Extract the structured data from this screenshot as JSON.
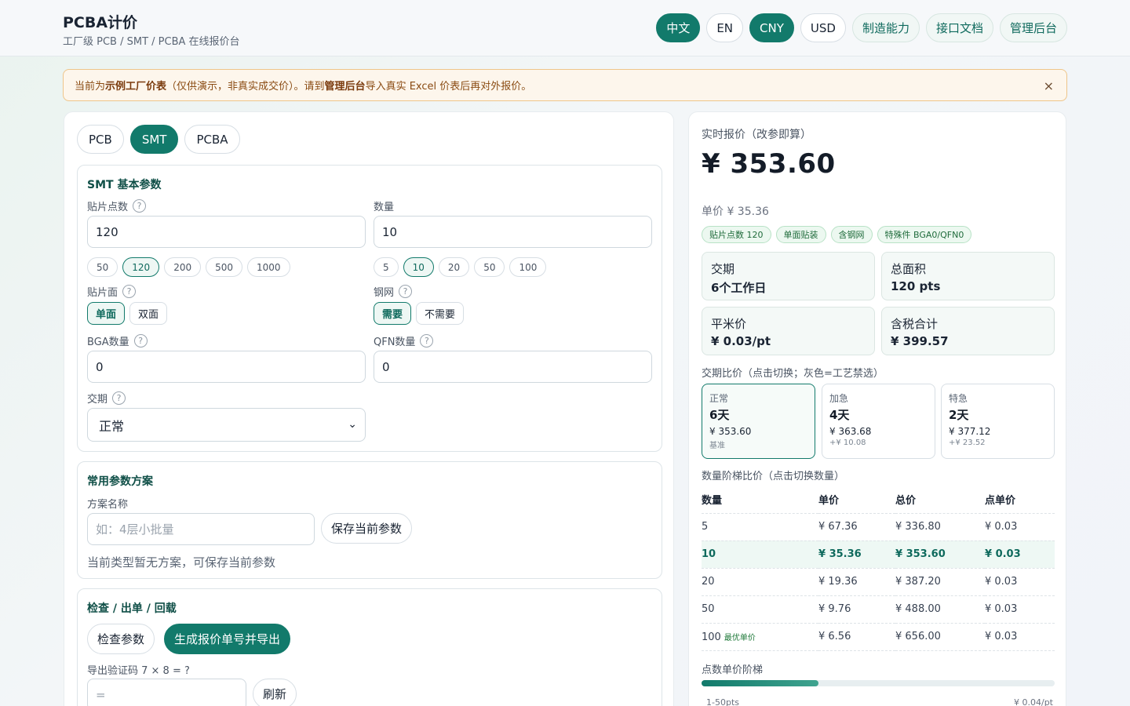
{
  "header": {
    "title": "PCBA计价",
    "subtitle": "工厂级 PCB / SMT / PCBA 在线报价台",
    "lang": [
      "中文",
      "EN"
    ],
    "currency": [
      "CNY",
      "USD"
    ],
    "links": [
      "制造能力",
      "接口文档",
      "管理后台"
    ]
  },
  "banner": {
    "prefix": "当前为 ",
    "strong1": "示例工厂价表",
    "middle": "（仅供演示，非真实成交价）。请到 ",
    "strong2": "管理后台",
    "suffix": " 导入真实 Excel 价表后再对外报价。",
    "close": "×"
  },
  "tabs": [
    "PCB",
    "SMT",
    "PCBA"
  ],
  "basic": {
    "title": "SMT 基本参数",
    "points_label": "贴片点数",
    "points_value": "120",
    "points_chips": [
      "50",
      "120",
      "200",
      "500",
      "1000"
    ],
    "qty_label": "数量",
    "qty_value": "10",
    "qty_chips": [
      "5",
      "10",
      "20",
      "50",
      "100"
    ],
    "side_label": "贴片面",
    "side_options": [
      "单面",
      "双面"
    ],
    "stencil_label": "钢网",
    "stencil_options": [
      "需要",
      "不需要"
    ],
    "bga_label": "BGA数量",
    "bga_value": "0",
    "qfn_label": "QFN数量",
    "qfn_value": "0",
    "lead_label": "交期",
    "lead_value": "正常"
  },
  "presets": {
    "title": "常用参数方案",
    "name_label": "方案名称",
    "name_placeholder": "如：4层小批量",
    "save_button": "保存当前参数",
    "empty_text": "当前类型暂无方案，可保存当前参数"
  },
  "export": {
    "title": "检查 / 出单 / 回载",
    "check_button": "检查参数",
    "generate_button": "生成报价单号并导出",
    "captcha_label": "导出验证码 7 × 8 = ?",
    "captcha_placeholder": "=",
    "refresh_button": "刷新"
  },
  "quote": {
    "label": "实时报价（改参即算）",
    "price": "¥ 353.60",
    "unit_price": "单价 ¥ 35.36",
    "tags": [
      "贴片点数 120",
      "单面贴装",
      "含钢网",
      "特殊件 BGA0/QFN0"
    ],
    "stats": [
      {
        "k": "交期",
        "v": "6个工作日"
      },
      {
        "k": "总面积",
        "v": "120 pts"
      },
      {
        "k": "平米价",
        "v": "¥ 0.03/pt"
      },
      {
        "k": "含税合计",
        "v": "¥ 399.57"
      }
    ],
    "lead_title": "交期比价（点击切换；灰色=工艺禁选）",
    "leads": [
      {
        "name": "正常",
        "days": "6天",
        "price": "¥ 353.60",
        "extra": "基准"
      },
      {
        "name": "加急",
        "days": "4天",
        "price": "¥ 363.68",
        "extra": "+¥ 10.08"
      },
      {
        "name": "特急",
        "days": "2天",
        "price": "¥ 377.12",
        "extra": "+¥ 23.52"
      }
    ],
    "tier_title": "数量阶梯比价（点击切换数量）",
    "tier_headers": [
      "数量",
      "单价",
      "总价",
      "点单价"
    ],
    "tiers": [
      {
        "qty": "5",
        "unit": "¥ 67.36",
        "total": "¥ 336.80",
        "pt": "¥ 0.03",
        "best": ""
      },
      {
        "qty": "10",
        "unit": "¥ 35.36",
        "total": "¥ 353.60",
        "pt": "¥ 0.03",
        "best": ""
      },
      {
        "qty": "20",
        "unit": "¥ 19.36",
        "total": "¥ 387.20",
        "pt": "¥ 0.03",
        "best": ""
      },
      {
        "qty": "50",
        "unit": "¥ 9.76",
        "total": "¥ 488.00",
        "pt": "¥ 0.03",
        "best": ""
      },
      {
        "qty": "100",
        "unit": "¥ 6.56",
        "total": "¥ 656.00",
        "pt": "¥ 0.03",
        "best": "最优单价"
      }
    ],
    "ladder_title": "点数单价阶梯",
    "ladder_fill": 0.33,
    "ladder_left": "1-50pts",
    "ladder_right": "¥ 0.04/pt"
  },
  "colors": {
    "primary": "#127a6b",
    "banner_bg": "#fdf6ec",
    "tag_bg": "#ecf8f0"
  }
}
